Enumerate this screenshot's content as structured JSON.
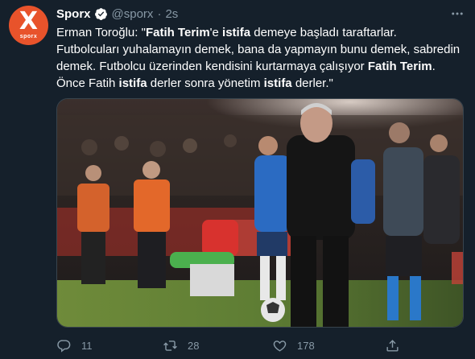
{
  "tweet": {
    "avatar_text": "sporx",
    "name": "Sporx",
    "handle": "@sporx",
    "dot": "·",
    "time": "2s",
    "text": {
      "l1_a": "Erman Toroğlu: \"",
      "l1_b": "Fatih Terim",
      "l1_c": "'e ",
      "l1_d": "istifa",
      "l1_e": " demeye başladı taraftarlar.",
      "l2": "Futbolcuları yuhalamayın demek, bana da yapmayın bunu demek, sabredin",
      "l3_a": "demek. Futbolcu üzerinden kendisini kurtarmaya çalışıyor ",
      "l3_b": "Fatih Terim",
      "l3_c": ".",
      "l4_a": "Önce Fatih ",
      "l4_b": "istifa",
      "l4_c": " derler sonra yönetim ",
      "l4_d": "istifa",
      "l4_e": " derler.\""
    },
    "actions": {
      "reply_count": "11",
      "retweet_count": "28",
      "like_count": "178"
    }
  },
  "colors": {
    "background": "#15202b",
    "muted": "#8899a6",
    "verified": "#ffffff",
    "avatar": "#e8532b"
  },
  "icons": [
    "x-logo",
    "verified-badge-icon",
    "more-icon",
    "reply-icon",
    "retweet-icon",
    "like-icon",
    "share-icon"
  ]
}
